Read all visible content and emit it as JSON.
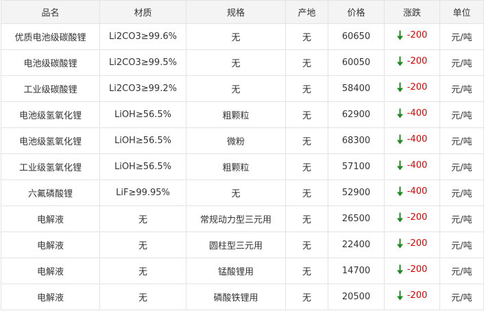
{
  "table": {
    "headers": [
      "品名",
      "材质",
      "规格",
      "产地",
      "价格",
      "涨跌",
      "单位"
    ],
    "rows": [
      {
        "name": "优质电池级碳酸锂",
        "material": "Li2CO3≥99.6%",
        "spec": "无",
        "origin": "无",
        "price": "60650",
        "change": "-200",
        "unit": "元/吨"
      },
      {
        "name": "电池级碳酸锂",
        "material": "Li2CO3≥99.5%",
        "spec": "无",
        "origin": "无",
        "price": "60050",
        "change": "-200",
        "unit": "元/吨"
      },
      {
        "name": "工业级碳酸锂",
        "material": "Li2CO3≥99.2%",
        "spec": "无",
        "origin": "无",
        "price": "58400",
        "change": "-200",
        "unit": "元/吨"
      },
      {
        "name": "电池级氢氧化锂",
        "material": "LiOH≥56.5%",
        "spec": "粗颗粒",
        "origin": "无",
        "price": "62900",
        "change": "-400",
        "unit": "元/吨"
      },
      {
        "name": "电池级氢氧化锂",
        "material": "LiOH≥56.5%",
        "spec": "微粉",
        "origin": "无",
        "price": "68300",
        "change": "-400",
        "unit": "元/吨"
      },
      {
        "name": "工业级氢氧化锂",
        "material": "LiOH≥56.5%",
        "spec": "粗颗粒",
        "origin": "无",
        "price": "57100",
        "change": "-400",
        "unit": "元/吨"
      },
      {
        "name": "六氟磷酸锂",
        "material": "LiF≥99.95%",
        "spec": "无",
        "origin": "无",
        "price": "52900",
        "change": "-400",
        "unit": "元/吨"
      },
      {
        "name": "电解液",
        "material": "无",
        "spec": "常规动力型三元用",
        "origin": "无",
        "price": "26500",
        "change": "-200",
        "unit": "元/吨"
      },
      {
        "name": "电解液",
        "material": "无",
        "spec": "圆柱型三元用",
        "origin": "无",
        "price": "22400",
        "change": "-200",
        "unit": "元/吨"
      },
      {
        "name": "电解液",
        "material": "无",
        "spec": "锰酸锂用",
        "origin": "无",
        "price": "14700",
        "change": "-200",
        "unit": "元/吨"
      },
      {
        "name": "电解液",
        "material": "无",
        "spec": "磷酸铁锂用",
        "origin": "无",
        "price": "20500",
        "change": "-200",
        "unit": "元/吨"
      }
    ]
  },
  "icons": {
    "change_direction": "arrow-down-icon"
  },
  "colors": {
    "down_arrow": "#1e8a1e",
    "change_text": "#e60000",
    "header_bg": "#f4f4f4",
    "border": "#e3e3e3"
  }
}
